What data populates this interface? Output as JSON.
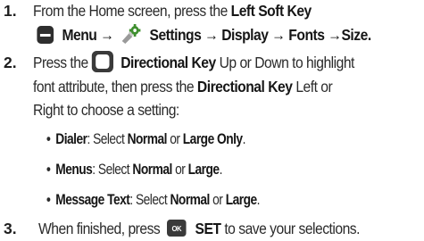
{
  "step1": {
    "number": "1.",
    "intro": "From the Home screen, press the",
    "left_soft_key": "Left Soft Key",
    "menu": "Menu",
    "arrow": "→",
    "settings": "Settings",
    "display": "Display",
    "fonts": "Fonts",
    "size": "Size",
    "period": "."
  },
  "step2": {
    "number": "2.",
    "press_the": "Press the",
    "directional_key": "Directional Key",
    "up_down": "Up or Down to highlight",
    "line2": "font attribute, then press the",
    "directional_key_2": "Directional Key",
    "left_or": "Left or",
    "line3": "Right to choose a setting:",
    "bullets": [
      {
        "label": "Dialer",
        "colon": ": Select",
        "opt1": "Normal",
        "or": "or",
        "opt2": "Large Only",
        "end": "."
      },
      {
        "label": "Menus",
        "colon": ": Select",
        "opt1": "Normal",
        "or": "or",
        "opt2": "Large",
        "end": "."
      },
      {
        "label": "Message Text",
        "colon": ": Select",
        "opt1": "Normal",
        "or": "or",
        "opt2": "Large",
        "end": "."
      }
    ]
  },
  "step3": {
    "number": "3.",
    "intro": "When finished, press",
    "ok_icon_text": "OK",
    "set": "SET",
    "rest": "to save your selections."
  },
  "icons": {
    "softkey": "left-soft-key-icon",
    "settings": "settings-icon",
    "directional": "directional-key-icon",
    "ok": "ok-key-icon"
  },
  "colors": {
    "text": "#2a2a2a",
    "icon_dark": "#3a3a3a",
    "softkey_fill": "#2e2e2e",
    "settings_green": "#3f8f2f"
  }
}
